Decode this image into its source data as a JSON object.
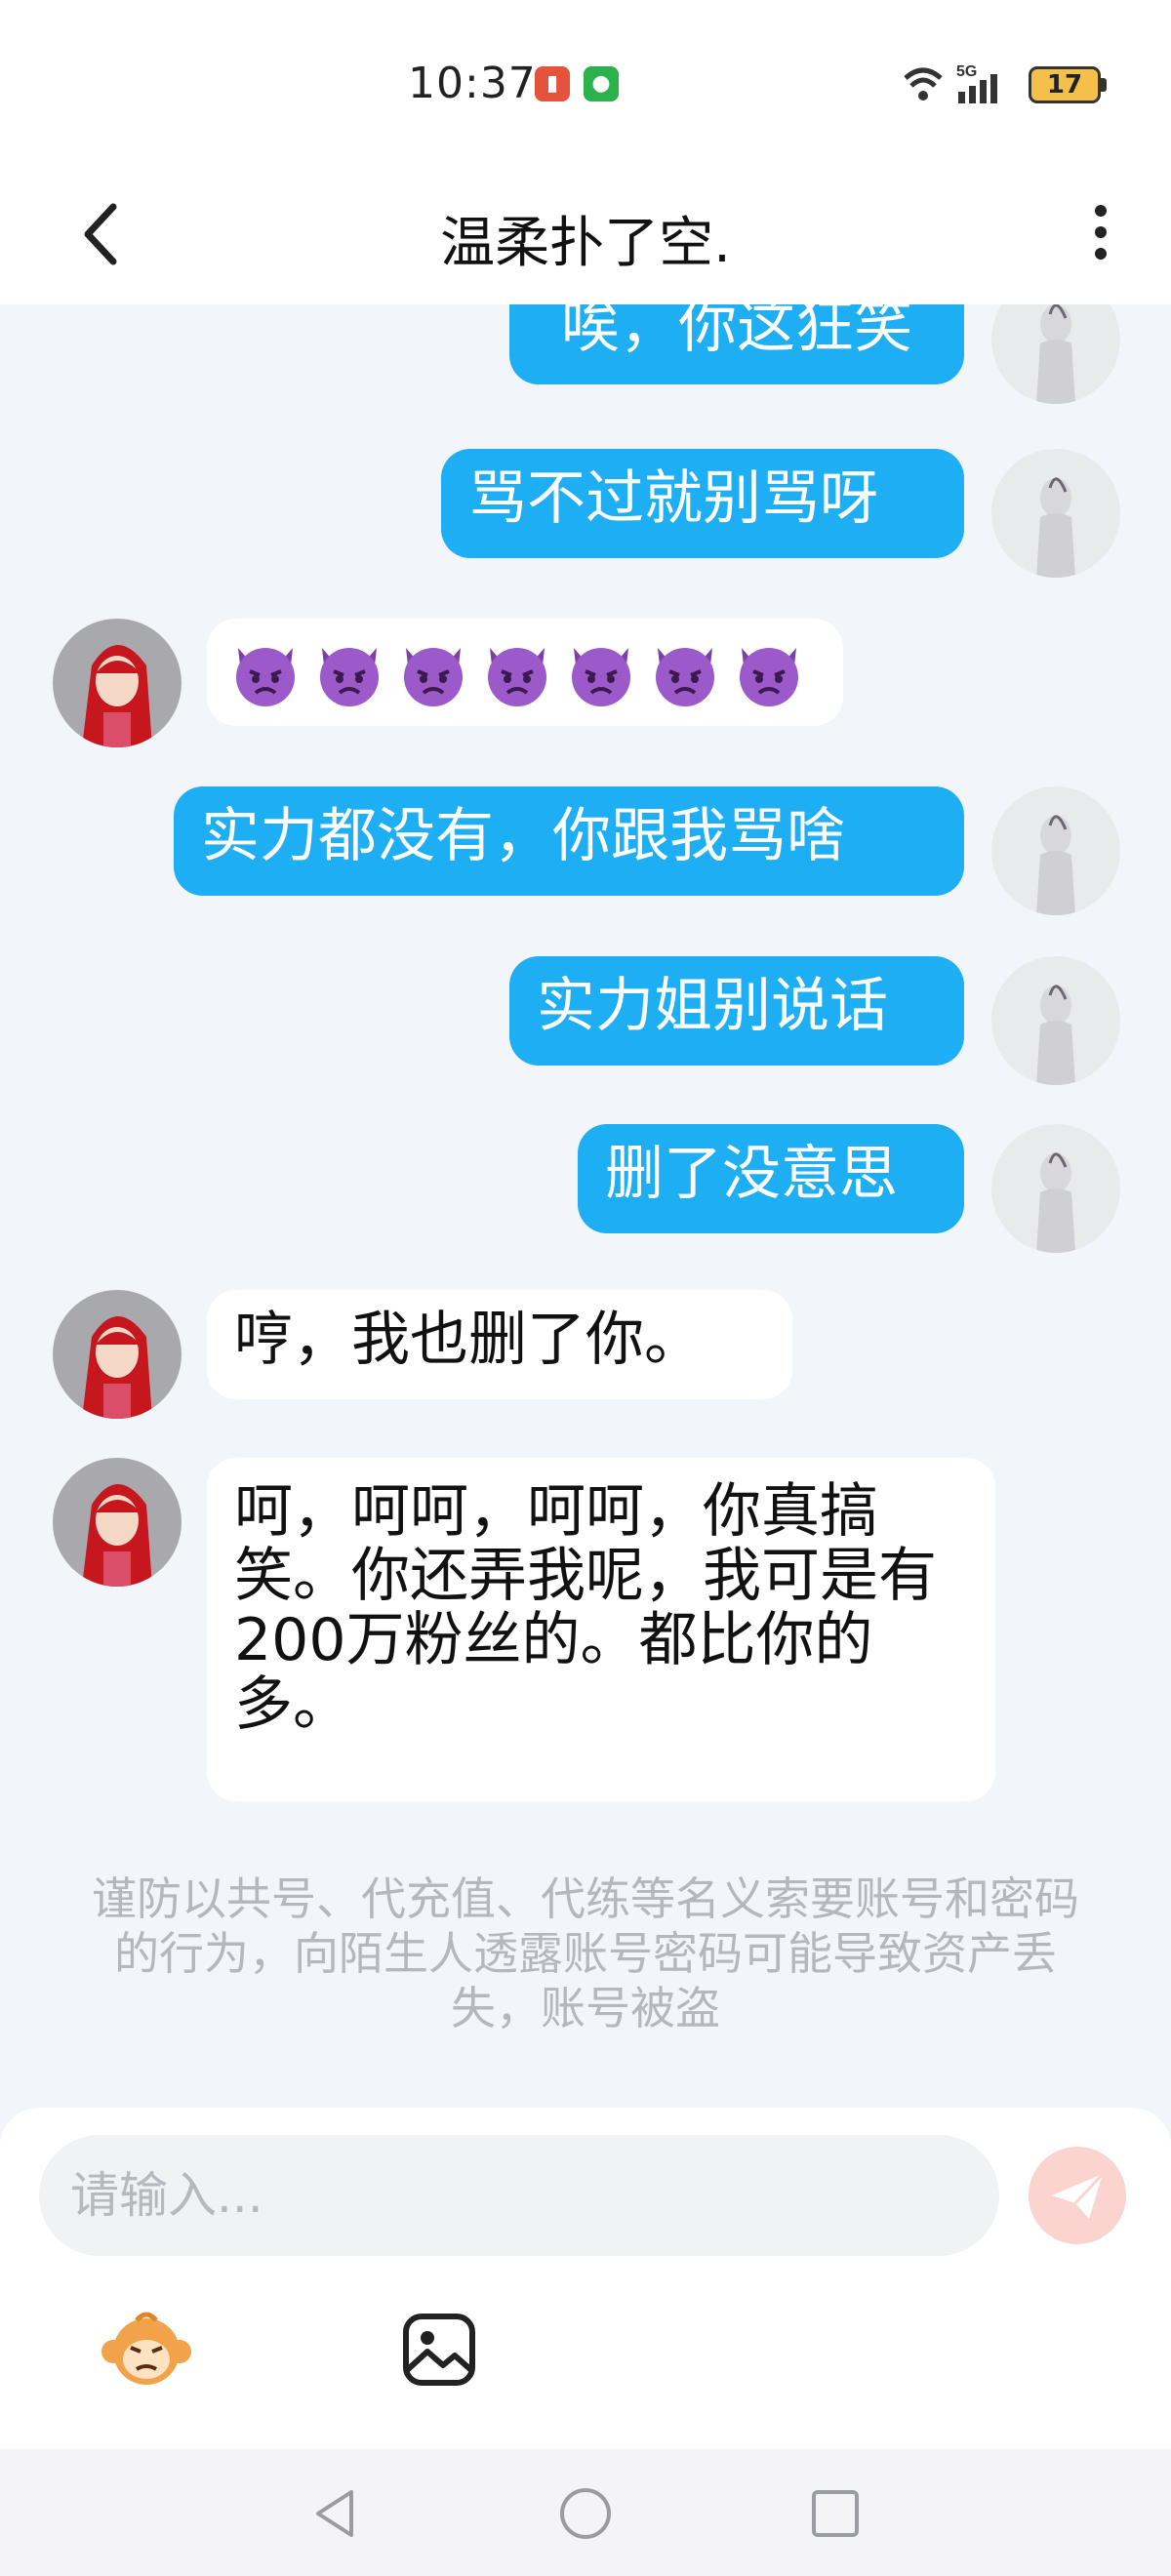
{
  "status_bar": {
    "time": "10:37",
    "battery": "17",
    "signal_label": "5G"
  },
  "header": {
    "title": "温柔扑了空."
  },
  "messages": [
    {
      "side": "right",
      "text": "唉，你这狂笑"
    },
    {
      "side": "right",
      "text": "骂不过就别骂呀"
    },
    {
      "side": "left",
      "type": "emoji",
      "emoji": "angry-devil-face",
      "count": 7
    },
    {
      "side": "right",
      "text": "实力都没有，你跟我骂啥"
    },
    {
      "side": "right",
      "text": "实力姐别说话"
    },
    {
      "side": "right",
      "text": "删了没意思"
    },
    {
      "side": "left",
      "text": "哼，我也删了你。"
    },
    {
      "side": "left",
      "text": "呵，呵呵，呵呵，你真搞笑。你还弄我呢，我可是有200万粉丝的。都比你的多。"
    }
  ],
  "warning": "谨防以共号、代充值、代练等名义索要账号和密码的行为，向陌生人透露账号密码可能导致资产丢失，账号被盗",
  "input": {
    "placeholder": "请输入..."
  },
  "colors": {
    "outgoing_bubble": "#1eaef3",
    "incoming_bubble": "#ffffff",
    "background": "#f2f5f9",
    "send_button": "#fbd3cf"
  },
  "icons": {
    "back": "chevron-left-icon",
    "more": "more-vertical-icon",
    "send": "paper-plane-icon",
    "emoji_tool": "monkey-sticker-icon",
    "image_tool": "image-icon"
  }
}
